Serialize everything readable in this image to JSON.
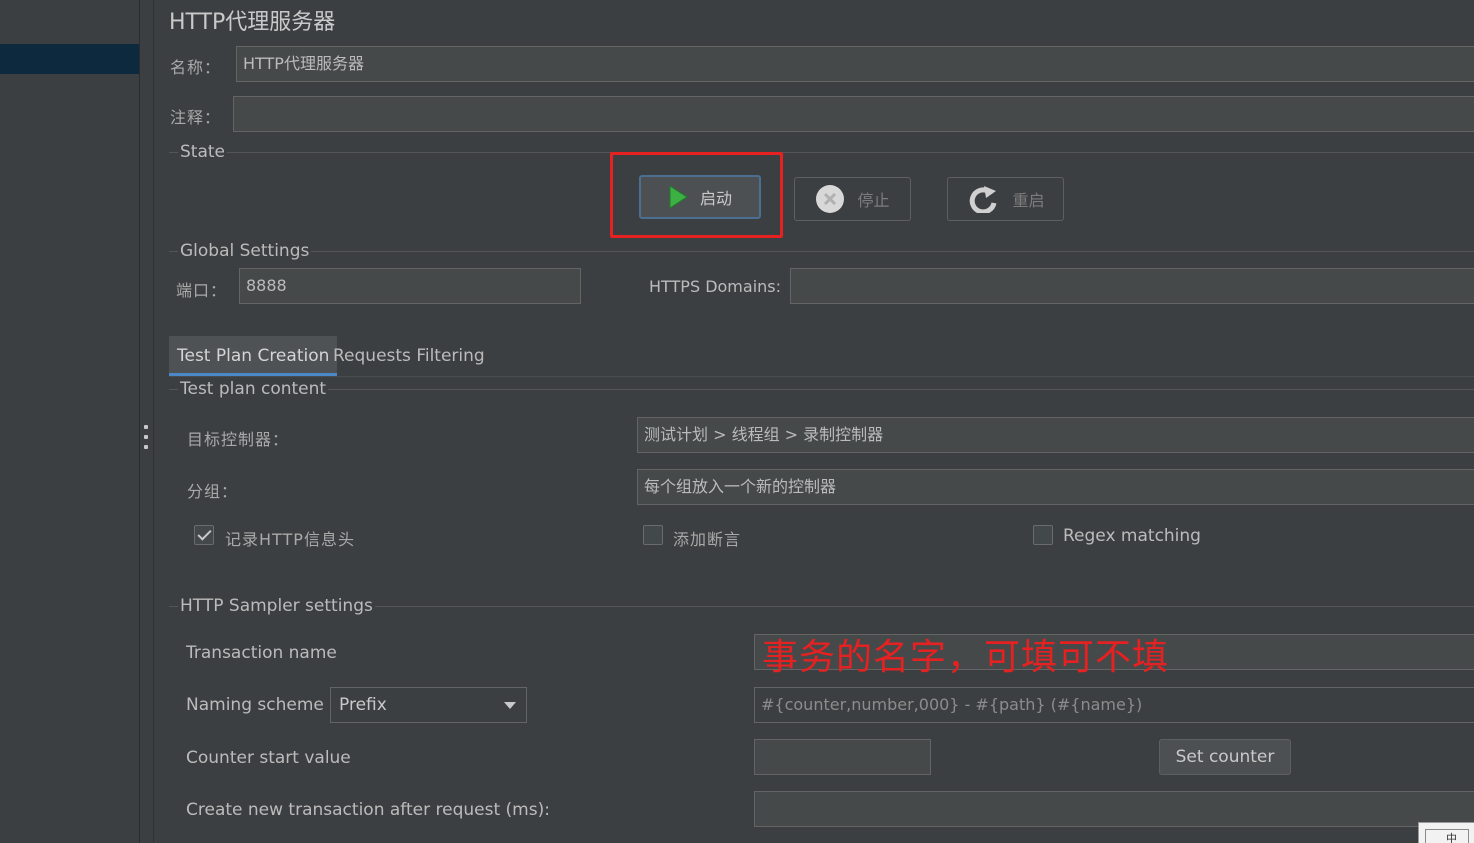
{
  "title": "HTTP代理服务器",
  "name_field": {
    "label": "名称：",
    "value": "HTTP代理服务器"
  },
  "comment_field": {
    "label": "注释：",
    "value": ""
  },
  "state": {
    "title": "State",
    "start": "启动",
    "stop": "停止",
    "restart": "重启"
  },
  "global": {
    "title": "Global Settings",
    "port_label": "端口：",
    "port_value": "8888",
    "https_label": "HTTPS Domains:",
    "https_value": ""
  },
  "tabs": [
    {
      "label": "Test Plan Creation",
      "active": true
    },
    {
      "label": "Requests Filtering",
      "active": false
    }
  ],
  "test_plan": {
    "title": "Test plan content",
    "target_label": "目标控制器：",
    "target_value": "测试计划 > 线程组 > 录制控制器",
    "group_label": "分组：",
    "group_value": "每个组放入一个新的控制器",
    "record_headers": {
      "label": "记录HTTP信息头",
      "checked": true
    },
    "add_assertions": {
      "label": "添加断言",
      "checked": false
    },
    "regex_matching": {
      "label": "Regex matching",
      "checked": false
    }
  },
  "sampler": {
    "title": "HTTP Sampler settings",
    "transaction_label": "Transaction name",
    "transaction_annotation": "事务的名字，可填可不填",
    "naming_label": "Naming scheme",
    "naming_value": "Prefix",
    "naming_format": "#{counter,number,000} - #{path} (#{name})",
    "counter_label": "Counter start value",
    "counter_value": "",
    "set_counter": "Set counter",
    "create_tx_label": "Create new transaction after request (ms):",
    "create_tx_value": ""
  },
  "corner_widget_text": "中",
  "colors": {
    "background": "#3c3f41",
    "field_bg": "#45494a",
    "selection": "#0d293e",
    "highlight": "#e52121",
    "play_green": "#3cb043"
  },
  "icons": {
    "start": "play-icon",
    "stop": "stop-icon",
    "restart": "restart-icon",
    "splitter": "grip-icon",
    "dropdown": "chevron-down-icon"
  }
}
